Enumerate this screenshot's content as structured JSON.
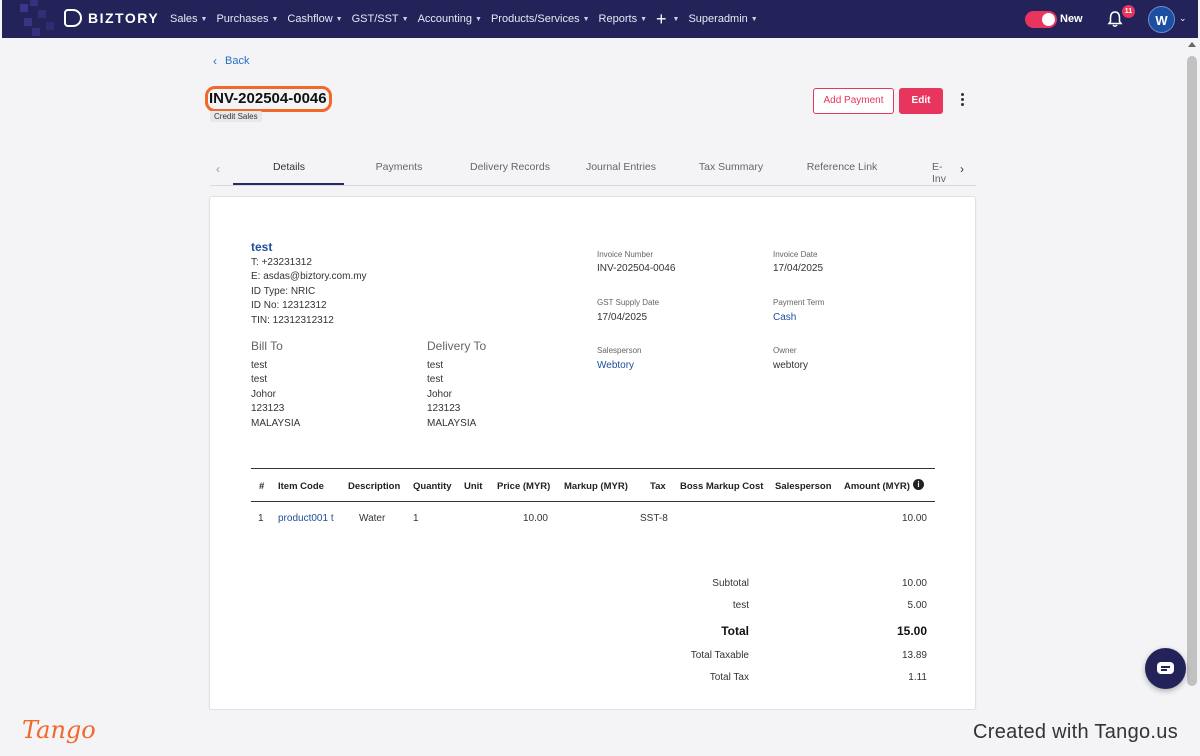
{
  "app": {
    "brand": "BIZTORY"
  },
  "nav": {
    "items": [
      {
        "label": "Sales"
      },
      {
        "label": "Purchases"
      },
      {
        "label": "Cashflow"
      },
      {
        "label": "GST/SST"
      },
      {
        "label": "Accounting"
      },
      {
        "label": "Products/Services"
      },
      {
        "label": "Reports"
      }
    ],
    "plus_icon": "plus-icon",
    "superadmin": "Superadmin",
    "toggle_label": "New",
    "notification_count": "11",
    "avatar_initial": "W"
  },
  "page": {
    "back_label": "Back",
    "invoice_title": "INV-202504-0046",
    "invoice_type": "Credit Sales",
    "add_payment_label": "Add Payment",
    "edit_label": "Edit"
  },
  "tabs": [
    {
      "label": "Details",
      "active": true
    },
    {
      "label": "Payments",
      "active": false
    },
    {
      "label": "Delivery Records",
      "active": false
    },
    {
      "label": "Journal Entries",
      "active": false
    },
    {
      "label": "Tax Summary",
      "active": false
    },
    {
      "label": "Reference Link",
      "active": false
    },
    {
      "label": "E-Inv",
      "active": false
    }
  ],
  "customer": {
    "name": "test",
    "lines": [
      "T: +23231312",
      "E: asdas@biztory.com.my",
      "ID Type: NRIC",
      "ID No: 12312312",
      "TIN: 12312312312"
    ]
  },
  "bill_to": {
    "title": "Bill To",
    "lines": [
      "test",
      "test",
      "Johor",
      "123123",
      "MALAYSIA"
    ]
  },
  "delivery_to": {
    "title": "Delivery To",
    "lines": [
      "test",
      "test",
      "Johor",
      "123123",
      "MALAYSIA"
    ]
  },
  "meta": {
    "invoice_number_label": "Invoice Number",
    "invoice_number": "INV-202504-0046",
    "invoice_date_label": "Invoice Date",
    "invoice_date": "17/04/2025",
    "gst_supply_date_label": "GST Supply Date",
    "gst_supply_date": "17/04/2025",
    "payment_term_label": "Payment Term",
    "payment_term": "Cash",
    "salesperson_label": "Salesperson",
    "salesperson": "Webtory",
    "owner_label": "Owner",
    "owner": "webtory"
  },
  "table": {
    "headers": [
      "#",
      "Item Code",
      "Description",
      "Quantity",
      "Unit",
      "Price (MYR)",
      "Markup (MYR)",
      "Tax",
      "Boss Markup Cost",
      "Salesperson",
      "Amount (MYR)"
    ],
    "rows": [
      {
        "num": "1",
        "item_code": "product001 t",
        "description": "Water",
        "quantity": "1",
        "unit": "",
        "price": "10.00",
        "markup": "",
        "tax": "SST-8",
        "boss_markup": "",
        "salesperson": "",
        "amount": "10.00"
      }
    ]
  },
  "totals": {
    "subtotal_label": "Subtotal",
    "subtotal": "10.00",
    "extra_label": "test",
    "extra": "5.00",
    "total_label": "Total",
    "total": "15.00",
    "taxable_label": "Total Taxable",
    "taxable": "13.89",
    "tax_label": "Total Tax",
    "tax": "1.11"
  },
  "footer": {
    "logo_text": "Tango",
    "credit": "Created with Tango.us"
  }
}
